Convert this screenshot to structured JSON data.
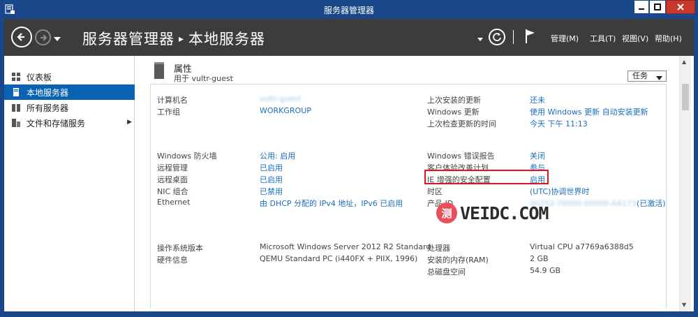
{
  "window": {
    "title": "服务器管理器"
  },
  "header": {
    "breadcrumb_root": "服务器管理器",
    "breadcrumb_separator": "▸",
    "breadcrumb_current": "本地服务器",
    "menu_manage": "管理(M)",
    "menu_tools": "工具(T)",
    "menu_view": "视图(V)",
    "menu_help": "帮助(H)"
  },
  "sidebar": {
    "items": [
      {
        "label": "仪表板",
        "icon": "dashboard-icon"
      },
      {
        "label": "本地服务器",
        "icon": "local-server-icon"
      },
      {
        "label": "所有服务器",
        "icon": "all-servers-icon"
      },
      {
        "label": "文件和存储服务",
        "icon": "storage-icon"
      }
    ]
  },
  "properties": {
    "title": "属性",
    "subtitle": "用于 vultr-guest",
    "tasks_label": "任务",
    "computer_name_label": "计算机名",
    "computer_name_value": "vultr-guest",
    "workgroup_label": "工作组",
    "workgroup_value": "WORKGROUP",
    "last_updates_label": "上次安装的更新",
    "last_updates_value": "还未",
    "windows_update_label": "Windows 更新",
    "windows_update_value": "使用 Windows 更新 自动安装更新",
    "last_check_label": "上次检查更新的时间",
    "last_check_value": "今天 下午 11:13",
    "firewall_label": "Windows 防火墙",
    "firewall_value": "公用: 启用",
    "remote_mgmt_label": "远程管理",
    "remote_mgmt_value": "已启用",
    "remote_desktop_label": "远程桌面",
    "remote_desktop_value": "已启用",
    "nic_label": "NIC 组合",
    "nic_value": "已禁用",
    "ethernet_label": "Ethernet",
    "ethernet_value": "由 DHCP 分配的 IPv4 地址，IPv6 已启用",
    "error_report_label": "Windows 错误报告",
    "error_report_value": "关闭",
    "ceip_label": "客户体验改善计划",
    "ceip_value": "参与",
    "ie_esc_label": "IE 增强的安全配置",
    "ie_esc_value": "启用",
    "timezone_label": "时区",
    "timezone_value": "(UTC)协调世界时",
    "product_id_label": "产品 ID",
    "product_id_value": "00252-70000-00000-AA173",
    "product_id_status": "(已激活)",
    "os_label": "操作系统版本",
    "os_value": "Microsoft Windows Server 2012 R2 Standard",
    "hardware_label": "硬件信息",
    "hardware_value": "QEMU Standard PC (i440FX + PIIX, 1996)",
    "cpu_label": "处理器",
    "cpu_value": "Virtual CPU a7769a6388d5",
    "memory_label": "安装的内存(RAM)",
    "memory_value": "2 GB",
    "disk_label": "总磁盘空间",
    "disk_value": "54.9 GB"
  },
  "watermark": {
    "badge": "测",
    "text": "VEIDC.COM"
  },
  "colors": {
    "title_bar": "#19478a",
    "header_bar": "#3c3c3c",
    "selected_item": "#0a62b3",
    "link": "#1a6ec0",
    "highlight": "#e0141e"
  }
}
